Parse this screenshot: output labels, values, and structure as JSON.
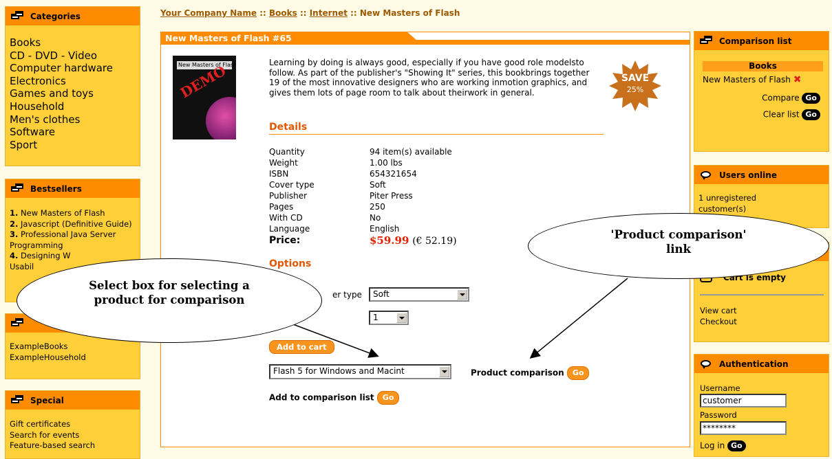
{
  "breadcrumb": {
    "company": "Your Company Name",
    "sep1": " :: ",
    "books": "Books",
    "sep2": " :: ",
    "internet": "Internet",
    "sep3": " :: ",
    "current": "New Masters of Flash"
  },
  "categories": {
    "title": "Categories",
    "items": [
      "Books",
      "CD - DVD - Video",
      "Computer hardware",
      "Electronics",
      "Games and toys",
      "Household",
      "Men's clothes",
      "Software",
      "Sport"
    ]
  },
  "bestsellers": {
    "title": "Bestsellers",
    "items": [
      {
        "num": "1.",
        "text": "New Masters of Flash"
      },
      {
        "num": "2.",
        "text": "Javascript (Definitive Guide)"
      },
      {
        "num": "3.",
        "text": "Professional Java Server Programming"
      },
      {
        "num": "4.",
        "text": "Designing W"
      },
      {
        "num": "",
        "text": "Usabil"
      }
    ]
  },
  "manufacturers": {
    "items": [
      "ExampleBooks",
      "ExampleHousehold"
    ]
  },
  "special": {
    "title": "Special",
    "items": [
      "Gift certificates",
      "Search for events",
      "Feature-based search"
    ]
  },
  "product": {
    "title": "New Masters of Flash #65",
    "image_title": "New Masters of Flash",
    "image_stamp": "DEMO",
    "description": "Learning by doing is always good, especially if you have good role modelsto follow. As part of the publisher's \"Showing It\" series, this bookbrings together 19 of the most innovative designers who are working inmotion graphics, and gives them lots of page room to talk about theirwork in general.",
    "save_label": "SAVE",
    "save_pct": "25%",
    "details_title": "Details",
    "details": [
      {
        "k": "Quantity",
        "v": "94 item(s) available"
      },
      {
        "k": "Weight",
        "v": "1.00 lbs"
      },
      {
        "k": "ISBN",
        "v": "654321654"
      },
      {
        "k": "Cover type",
        "v": "Soft"
      },
      {
        "k": "Publisher",
        "v": "Piter Press"
      },
      {
        "k": "Pages",
        "v": "250"
      },
      {
        "k": "With CD",
        "v": "No"
      },
      {
        "k": "Language",
        "v": "English"
      }
    ],
    "price_label": "Price:",
    "price": "$59.99",
    "price_alt": "(€ 52.19)",
    "options_title": "Options",
    "cover_label": "er type",
    "cover_value": "Soft",
    "qty_value": "1",
    "add_to_cart": "Add to cart",
    "compare_select": "Flash 5 for Windows and Macint",
    "product_comparison_label": "Product comparison",
    "add_comparison_label": "Add to comparison list",
    "go": "Go"
  },
  "comparison": {
    "title": "Comparison list",
    "category": "Books",
    "item": "New Masters of Flash",
    "compare": "Compare",
    "clear": "Clear list",
    "go": "Go"
  },
  "users_online": {
    "title": "Users online",
    "text": "1 unregistered customer(s)"
  },
  "cart": {
    "status": "Cart is empty",
    "view": "View cart",
    "checkout": "Checkout"
  },
  "auth": {
    "title": "Authentication",
    "username_label": "Username",
    "username": "customer",
    "password_label": "Password",
    "password": "********",
    "login": "Log in",
    "go": "Go"
  },
  "callouts": {
    "select_box": "Select box for selecting a product for comparison",
    "comparison_link": "'Product comparison' link"
  }
}
